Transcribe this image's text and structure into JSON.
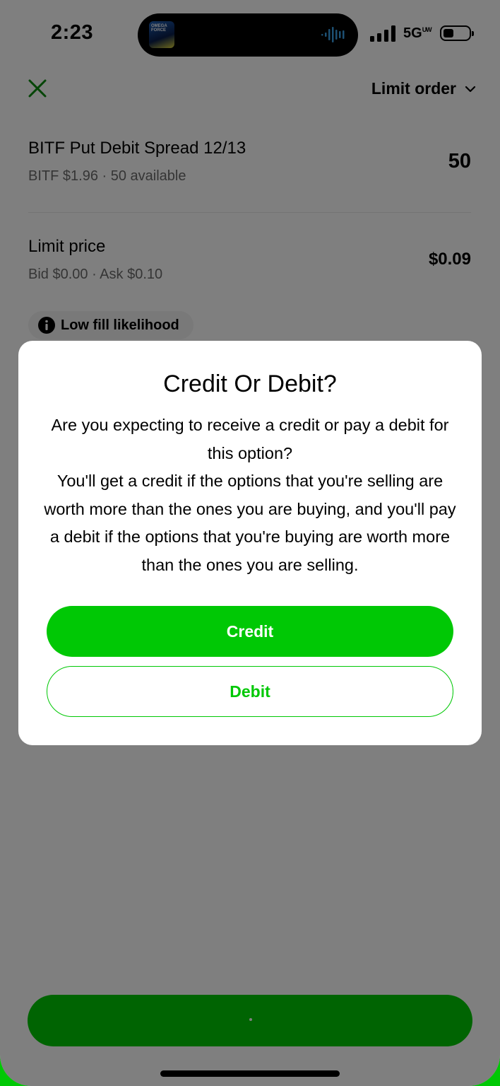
{
  "status_bar": {
    "time": "2:23",
    "network": "5G",
    "network_suffix": "UW",
    "album_text": "OMEGA FORCE"
  },
  "header": {
    "close_icon": "close-x-icon",
    "order_type": "Limit order"
  },
  "position": {
    "title": "BITF Put Debit Spread 12/13",
    "subtitle": "BITF $1.96 · 50 available",
    "quantity": "50"
  },
  "limit": {
    "title": "Limit price",
    "subtitle": "Bid $0.00 · Ask $0.10",
    "price": "$0.09"
  },
  "fill_badge": {
    "icon": "info-icon",
    "label": "Low fill likelihood"
  },
  "dialog": {
    "title": "Credit Or Debit?",
    "body_lines": [
      "Are you expecting to receive a credit or pay a debit for this option?",
      "You'll get a credit if the options that you're selling are worth more than the ones you are buying, and you'll pay a debit if the options that you're buying are worth more than the ones you are selling."
    ],
    "primary_button": "Credit",
    "secondary_button": "Debit"
  },
  "colors": {
    "accent": "#00c805",
    "overlay": "rgba(0,0,0,0.5)",
    "close_icon": "#0b8a0f"
  }
}
